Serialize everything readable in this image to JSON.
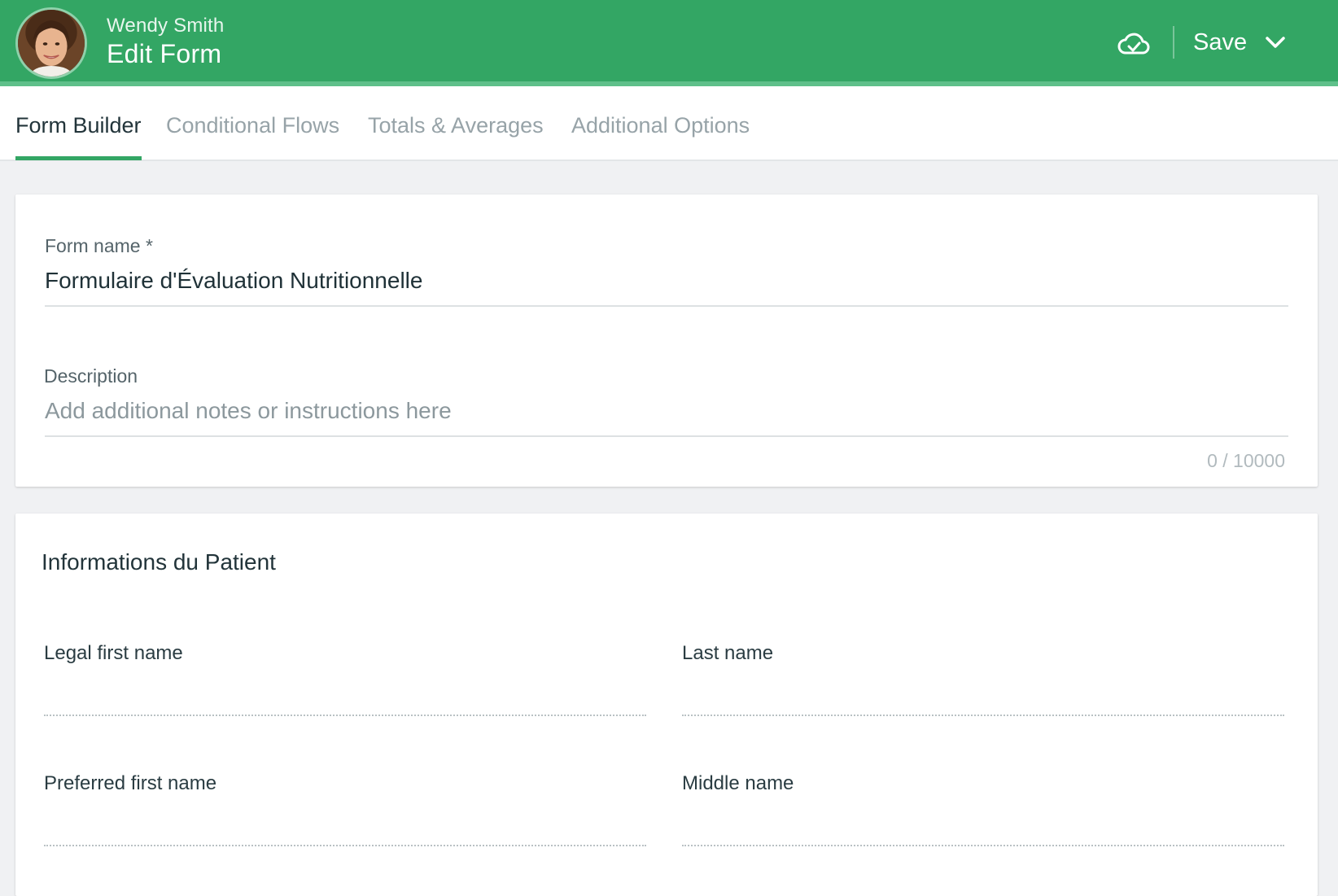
{
  "header": {
    "user_name": "Wendy Smith",
    "title": "Edit Form",
    "save_label": "Save",
    "icons": {
      "cloud": "cloud-check-icon",
      "save_menu": "chevron-down-icon",
      "avatar": "user-avatar"
    },
    "colors": {
      "bar": "#33a664",
      "bar_accent": "#5fc08a"
    }
  },
  "tabs": [
    {
      "label": "Form Builder",
      "active": true
    },
    {
      "label": "Conditional Flows",
      "active": false
    },
    {
      "label": "Totals & Averages",
      "active": false
    },
    {
      "label": "Additional Options",
      "active": false
    }
  ],
  "form_details": {
    "name_label": "Form name *",
    "name_value": "Formulaire d'Évaluation Nutritionnelle",
    "description_label": "Description",
    "description_placeholder": "Add additional notes or instructions here",
    "description_value": "",
    "char_counter": "0 / 10000"
  },
  "section": {
    "title": "Informations du Patient",
    "fields": [
      {
        "label": "Legal first name",
        "value": ""
      },
      {
        "label": "Last name",
        "value": ""
      },
      {
        "label": "Preferred first name",
        "value": ""
      },
      {
        "label": "Middle name",
        "value": ""
      }
    ]
  }
}
